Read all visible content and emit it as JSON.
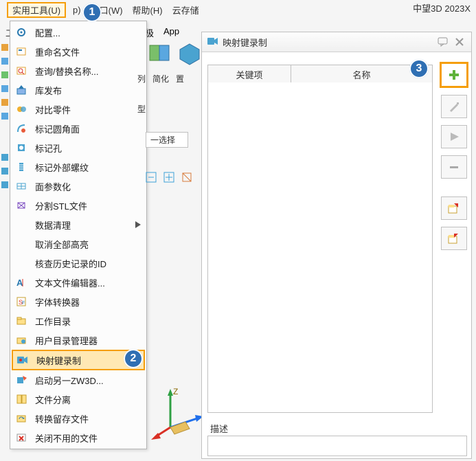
{
  "brand": "中望3D 2023X",
  "menu": {
    "utilities": "实用工具(U)",
    "p_frag": "p)",
    "window": "窗口(W)",
    "help": "帮助(H)",
    "cloud": "云存储"
  },
  "menu2": {
    "tool_frag": "工",
    "electrode_frag": "电极",
    "app": "App"
  },
  "dropdown": [
    {
      "label": "配置...",
      "icon": "gear"
    },
    {
      "label": "重命名文件",
      "icon": "rename"
    },
    {
      "label": "查询/替换名称...",
      "icon": "findreplace"
    },
    {
      "label": "库发布",
      "icon": "publish"
    },
    {
      "label": "对比零件",
      "icon": "compare"
    },
    {
      "label": "标记圆角面",
      "icon": "markfillet"
    },
    {
      "label": "标记孔",
      "icon": "markhole"
    },
    {
      "label": "标记外部螺纹",
      "icon": "markthread"
    },
    {
      "label": "面参数化",
      "icon": "faceparam"
    },
    {
      "label": "分割STL文件",
      "icon": "splitstl"
    },
    {
      "label": "数据清理",
      "icon": "dataclean",
      "submenu": true
    },
    {
      "label": "取消全部高亮",
      "icon": "none"
    },
    {
      "label": "核查历史记录的ID",
      "icon": "none"
    },
    {
      "label": "文本文件编辑器...",
      "icon": "texteditor"
    },
    {
      "label": "字体转换器",
      "icon": "fontconv"
    },
    {
      "label": "工作目录",
      "icon": "workdir"
    },
    {
      "label": "用户目录管理器",
      "icon": "userdir"
    },
    {
      "label": "映射键录制",
      "icon": "record",
      "selected": true
    },
    {
      "label": "启动另一ZW3D...",
      "icon": "launch"
    },
    {
      "label": "文件分离",
      "icon": "filesplit"
    },
    {
      "label": "转换留存文件",
      "icon": "convert"
    },
    {
      "label": "关闭不用的文件",
      "icon": "closeunused"
    }
  ],
  "ribbon": {
    "labels": [
      "列",
      "简化",
      "置"
    ],
    "type_frag": "型",
    "select_frag": "一选择"
  },
  "panel": {
    "title": "映射键录制",
    "columns": [
      "关键项",
      "名称"
    ],
    "desc_label": "描述",
    "add_tooltip": "add",
    "edit_tooltip": "edit",
    "play_tooltip": "play",
    "minus_tooltip": "remove",
    "import_tooltip": "import",
    "export_tooltip": "export"
  },
  "annotations": {
    "a1": "1",
    "a2": "2",
    "a3": "3"
  }
}
